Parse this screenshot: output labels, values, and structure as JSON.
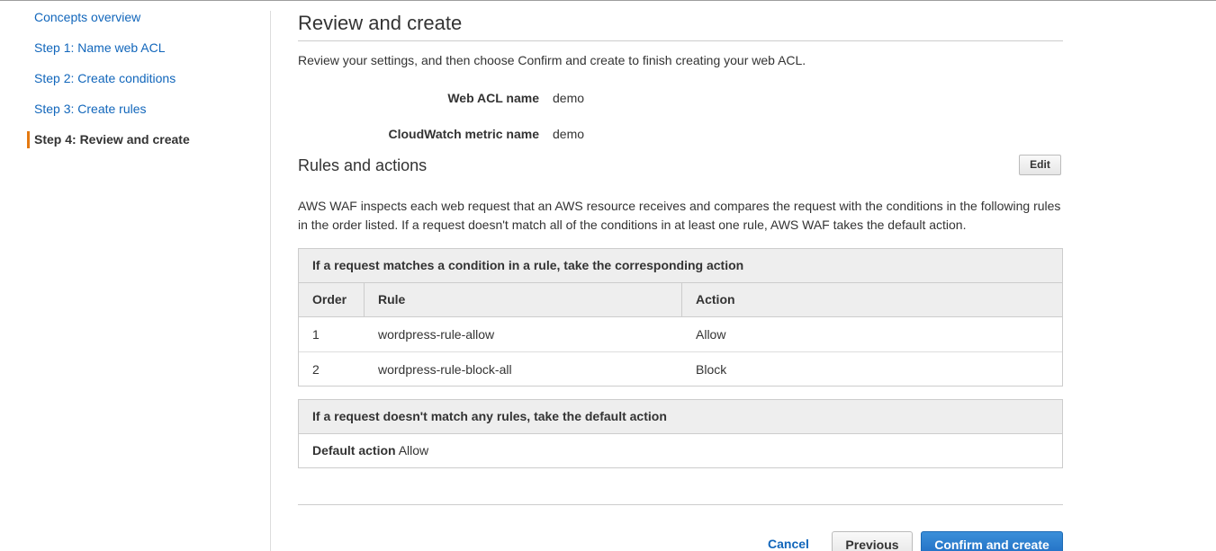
{
  "sidebar": {
    "items": [
      {
        "label": "Concepts overview"
      },
      {
        "label": "Step 1: Name web ACL"
      },
      {
        "label": "Step 2: Create conditions"
      },
      {
        "label": "Step 3: Create rules"
      },
      {
        "label": "Step 4: Review and create"
      }
    ],
    "active_index": 4
  },
  "main": {
    "title": "Review and create",
    "intro": "Review your settings, and then choose Confirm and create to finish creating your web ACL.",
    "settings": [
      {
        "label": "Web ACL name",
        "value": "demo"
      },
      {
        "label": "CloudWatch metric name",
        "value": "demo"
      }
    ],
    "rules_section": {
      "title": "Rules and actions",
      "edit_label": "Edit",
      "description": "AWS WAF inspects each web request that an AWS resource receives and compares the request with the conditions in the following rules in the order listed. If a request doesn't match all of the conditions in at least one rule, AWS WAF takes the default action."
    },
    "rules_table": {
      "caption": "If a request matches a condition in a rule, take the corresponding action",
      "headers": [
        "Order",
        "Rule",
        "Action"
      ],
      "rows": [
        {
          "order": "1",
          "rule": "wordpress-rule-allow",
          "action": "Allow"
        },
        {
          "order": "2",
          "rule": "wordpress-rule-block-all",
          "action": "Block"
        }
      ]
    },
    "default_table": {
      "caption": "If a request doesn't match any rules, take the default action",
      "label": "Default action",
      "value": "Allow"
    }
  },
  "footer": {
    "cancel_label": "Cancel",
    "previous_label": "Previous",
    "confirm_label": "Confirm and create"
  },
  "colors": {
    "link": "#1166bb",
    "active_marker": "#e47911",
    "primary_button": "#1f6cc2"
  }
}
